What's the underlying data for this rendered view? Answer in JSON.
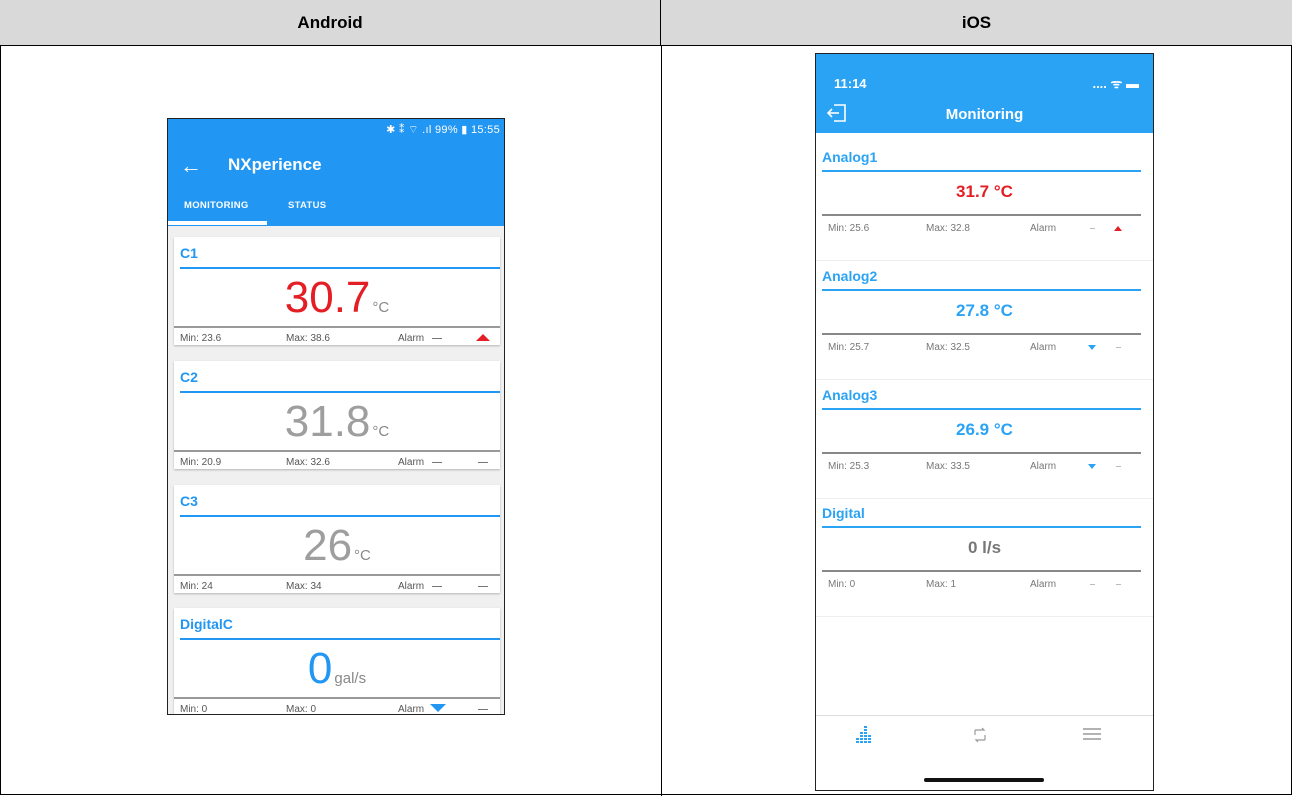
{
  "table": {
    "col_android": "Android",
    "col_ios": "iOS"
  },
  "colors": {
    "blue": "#2196f3",
    "red": "#e41e25",
    "gray": "#9e9e9e",
    "ios_blue": "#2aa3f5"
  },
  "android": {
    "status_bar": "✱ ⁑ ⌔ .ıl 99% ▮ 15:55",
    "back_icon": "arrow-left-icon",
    "title": "NXperience",
    "tabs": [
      {
        "label": "MONITORING",
        "active": true
      },
      {
        "label": "STATUS",
        "active": false
      }
    ],
    "cards": [
      {
        "name": "C1",
        "value": "30.7",
        "unit": "°C",
        "value_color": "red",
        "min": "Min: 23.6",
        "max": "Max: 38.6",
        "alarm": "Alarm",
        "low": "dash",
        "high": "up"
      },
      {
        "name": "C2",
        "value": "31.8",
        "unit": "°C",
        "value_color": "gray",
        "min": "Min: 20.9",
        "max": "Max: 32.6",
        "alarm": "Alarm",
        "low": "dash",
        "high": "dash"
      },
      {
        "name": "C3",
        "value": "26",
        "unit": "°C",
        "value_color": "gray",
        "min": "Min: 24",
        "max": "Max: 34",
        "alarm": "Alarm",
        "low": "dash",
        "high": "dash"
      },
      {
        "name": "DigitalC",
        "value": "0",
        "unit": "gal/s",
        "value_color": "blue",
        "min": "Min: 0",
        "max": "Max: 0",
        "alarm": "Alarm",
        "low": "down",
        "high": "dash"
      }
    ]
  },
  "ios": {
    "time": "11:14",
    "status_icons": ".... ᯤ ▬",
    "exit_icon": "exit-icon",
    "title": "Monitoring",
    "sections": [
      {
        "name": "Analog1",
        "value": "31.7 °C",
        "value_color": "red",
        "min": "Min: 25.6",
        "max": "Max: 32.8",
        "alarm": "Alarm",
        "low": "dash",
        "high": "up"
      },
      {
        "name": "Analog2",
        "value": "27.8 °C",
        "value_color": "blue",
        "min": "Min: 25.7",
        "max": "Max: 32.5",
        "alarm": "Alarm",
        "low": "down",
        "high": "dash"
      },
      {
        "name": "Analog3",
        "value": "26.9 °C",
        "value_color": "blue",
        "min": "Min: 25.3",
        "max": "Max: 33.5",
        "alarm": "Alarm",
        "low": "down",
        "high": "dash"
      },
      {
        "name": "Digital",
        "value": "0 l/s",
        "value_color": "gray",
        "min": "Min: 0",
        "max": "Max: 1",
        "alarm": "Alarm",
        "low": "dash",
        "high": "dash"
      }
    ],
    "tabbar": [
      "monitoring-chart-icon",
      "sync-icon",
      "menu-icon"
    ]
  }
}
